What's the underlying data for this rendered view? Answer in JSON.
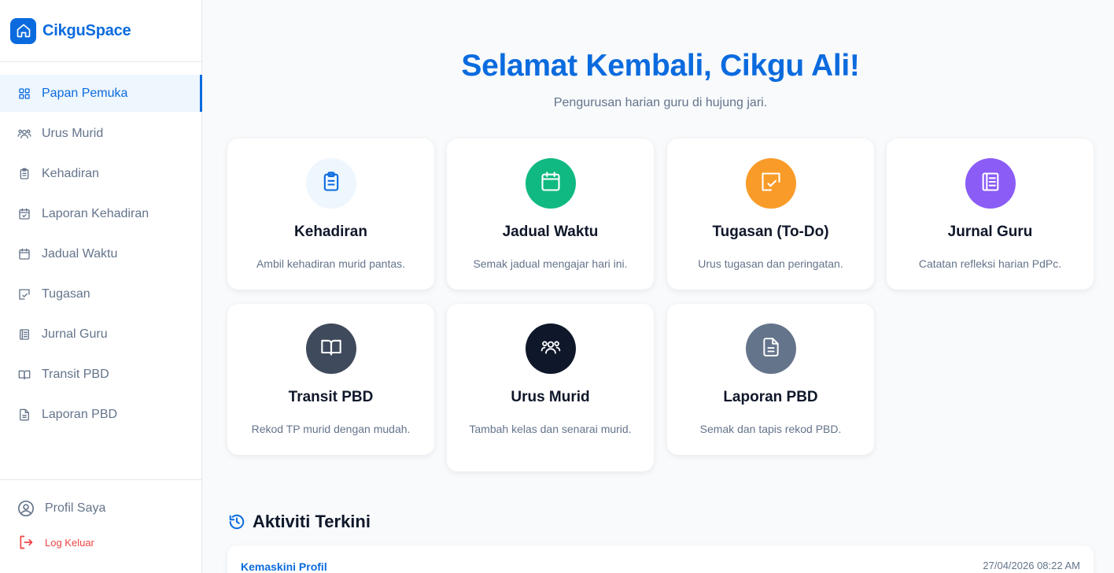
{
  "brand": {
    "name": "CikguSpace",
    "logo_icon": "home-icon",
    "color": "#0b6bde"
  },
  "sidebar": {
    "items": [
      {
        "label": "Papan Pemuka",
        "icon": "grid-icon",
        "active": true
      },
      {
        "label": "Urus Murid",
        "icon": "users-icon"
      },
      {
        "label": "Kehadiran",
        "icon": "clipboard-icon"
      },
      {
        "label": "Laporan Kehadiran",
        "icon": "calendar-check-icon"
      },
      {
        "label": "Jadual Waktu",
        "icon": "calendar-icon"
      },
      {
        "label": "Tugasan",
        "icon": "task-icon"
      },
      {
        "label": "Jurnal Guru",
        "icon": "journal-icon"
      },
      {
        "label": "Transit PBD",
        "icon": "book-open-icon"
      },
      {
        "label": "Laporan PBD",
        "icon": "file-text-icon"
      }
    ],
    "profile_label": "Profil Saya",
    "logout_label": "Log Keluar"
  },
  "hero": {
    "title": "Selamat Kembali, Cikgu Ali!",
    "subtitle": "Pengurusan harian guru di hujung jari."
  },
  "cards": [
    {
      "title": "Kehadiran",
      "desc": "Ambil kehadiran murid pantas.",
      "icon": "clipboard-icon",
      "bg": "#eef6fe",
      "fg": "#0b6bde"
    },
    {
      "title": "Jadual Waktu",
      "desc": "Semak jadual mengajar hari ini.",
      "icon": "calendar-icon",
      "bg": "#10b981",
      "fg": "#ffffff"
    },
    {
      "title": "Tugasan (To-Do)",
      "desc": "Urus tugasan dan peringatan.",
      "icon": "task-icon",
      "bg": "#f99b28",
      "fg": "#ffffff"
    },
    {
      "title": "Jurnal Guru",
      "desc": "Catatan refleksi harian PdPc.",
      "icon": "journal-icon",
      "bg": "#8b5cf6",
      "fg": "#ffffff"
    },
    {
      "title": "Transit PBD",
      "desc": "Rekod TP murid dengan mudah.",
      "icon": "book-open-icon",
      "bg": "#3f4a5c",
      "fg": "#ffffff"
    },
    {
      "title": "Urus Murid",
      "desc": "Tambah kelas dan senarai murid.",
      "icon": "users-icon",
      "bg": "#0f172a",
      "fg": "#ffffff"
    },
    {
      "title": "Laporan PBD",
      "desc": "Semak dan tapis rekod PBD.",
      "icon": "file-text-icon",
      "bg": "#64748b",
      "fg": "#ffffff"
    }
  ],
  "activity": {
    "heading": "Aktiviti Terkini",
    "icon": "history-icon",
    "items": [
      {
        "title": "Kemaskini Profil",
        "time": "27/04/2026 08:22 AM"
      }
    ]
  }
}
